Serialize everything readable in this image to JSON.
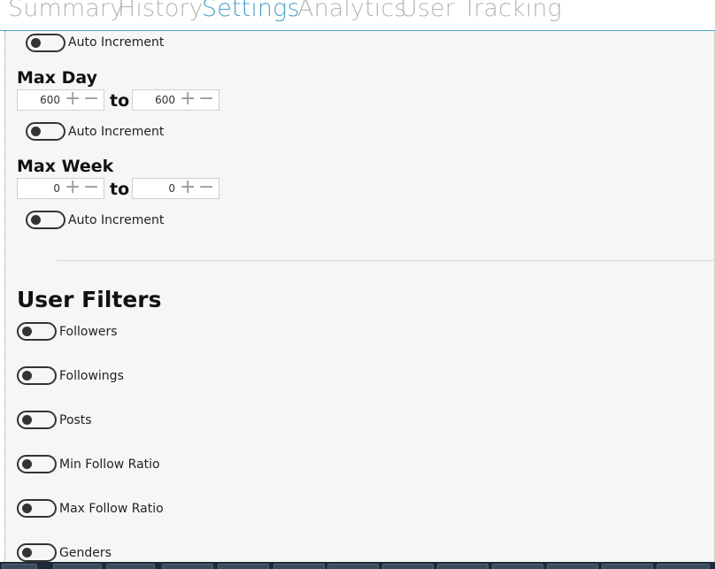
{
  "tabs": [
    {
      "label": "Summary",
      "active": false
    },
    {
      "label": "History",
      "active": false
    },
    {
      "label": "Settings",
      "active": true
    },
    {
      "label": "Analytics",
      "active": false
    },
    {
      "label": "User Tracking",
      "active": false
    }
  ],
  "colors": {
    "accent": "#4aa3c8",
    "inactive_tab": "#b5b5b5",
    "panel_bg": "#f6f6f6"
  },
  "auto_increment_label": "Auto Increment",
  "sections": {
    "max_day": {
      "title": "Max Day",
      "from": "600",
      "to_label": "to",
      "to": "600"
    },
    "max_week": {
      "title": "Max Week",
      "from": "0",
      "to_label": "to",
      "to": "0"
    }
  },
  "stepper_glyphs": {
    "plus": "+",
    "minus": "−"
  },
  "user_filters": {
    "title": "User Filters",
    "items": [
      {
        "label": "Followers"
      },
      {
        "label": "Followings"
      },
      {
        "label": "Posts"
      },
      {
        "label": "Min Follow Ratio"
      },
      {
        "label": "Max Follow Ratio"
      },
      {
        "label": "Genders"
      }
    ]
  }
}
